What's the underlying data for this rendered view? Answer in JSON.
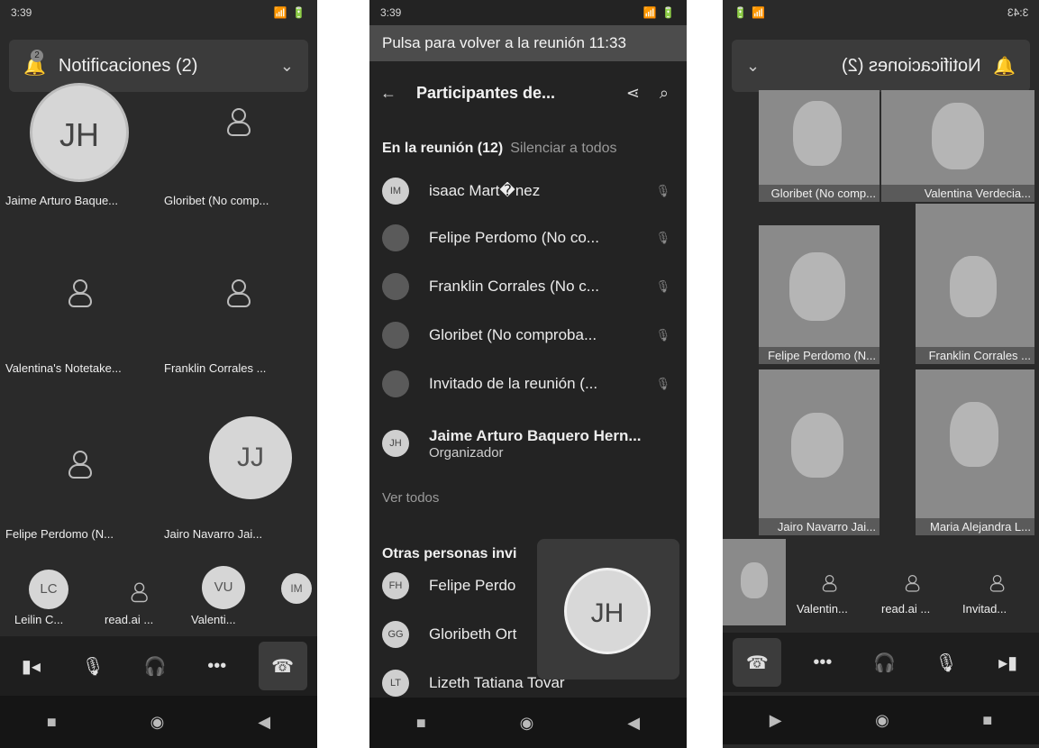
{
  "panel1": {
    "status_time": "3:39",
    "status_icons": "📶 🔋",
    "notifications_title": "Notificaciones (2)",
    "notifications_badge": "2",
    "tiles": [
      {
        "initials": "JH",
        "name": "Jaime Arturo Baque..."
      },
      {
        "name": "Gloribet  (No comp..."
      },
      {
        "name": "Valentina's Notetake..."
      },
      {
        "name": "Franklin Corrales  ..."
      },
      {
        "name": "Felipe Perdomo (N..."
      },
      {
        "initials": "JJ",
        "name": "Jairo Navarro Jai..."
      }
    ],
    "strip": [
      {
        "initials": "LC",
        "name": "Leilin C..."
      },
      {
        "name": "read.ai ..."
      },
      {
        "initials": "VU",
        "name": "Valenti..."
      },
      {
        "initials": "IM"
      }
    ]
  },
  "panel2": {
    "status_time": "3:39",
    "return_text": "Pulsa para volver a la reunión 11:33",
    "title": "Participantes de...",
    "in_meeting": "En la reunión (12)",
    "mute_all": "Silenciar a todos",
    "participants": [
      {
        "initials": "IM",
        "name": "isaac Mart�nez"
      },
      {
        "name": "Felipe Perdomo (No co..."
      },
      {
        "name": "Franklin Corrales  (No c..."
      },
      {
        "name": "Gloribet  (No comproba..."
      },
      {
        "name": "Invitado de la reunión (..."
      }
    ],
    "organizer": {
      "initials": "JH",
      "name": "Jaime Arturo Baquero Hern...",
      "role": "Organizador"
    },
    "see_all": "Ver todos",
    "others_header": "Otras personas invi",
    "others": [
      {
        "initials": "FH",
        "name": "Felipe  Perdo"
      },
      {
        "initials": "GG",
        "name": "Gloribeth  Ort"
      },
      {
        "initials": "LT",
        "name": "Lizeth Tatiana  Tovar"
      }
    ],
    "float_initials": "JH"
  },
  "panel3": {
    "status_time": "3:43",
    "notifications_title": "Notificaciones (2)",
    "videos": [
      {
        "name": "Valentina Verdecia..."
      },
      {
        "name": "Gloribet  (No comp..."
      },
      {
        "name": "Franklin Corrales  ..."
      },
      {
        "name": "Felipe Perdomo (N..."
      },
      {
        "name": "Maria Alejandra L..."
      },
      {
        "name": "Jairo Navarro Jai..."
      }
    ],
    "strip": [
      {
        "name": "Invitad..."
      },
      {
        "name": "read.ai ..."
      },
      {
        "name": "Valentin..."
      }
    ]
  }
}
